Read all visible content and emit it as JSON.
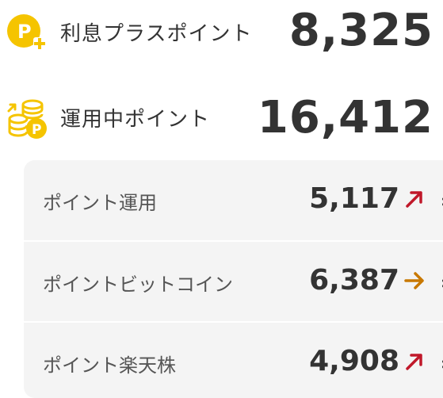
{
  "summary": {
    "interest_plus": {
      "label": "利息プラスポイント",
      "value": "8,325",
      "icon": "p-plus-coin-icon"
    },
    "invested": {
      "label": "運用中ポイント",
      "value": "16,412",
      "icon": "coin-stack-up-arrow-icon"
    }
  },
  "details": [
    {
      "label": "ポイント運用",
      "value": "5,117",
      "trend": "up",
      "trend_color": "#c0182a"
    },
    {
      "label": "ポイントビットコイン",
      "value": "6,387",
      "trend": "flat",
      "trend_color": "#c87800"
    },
    {
      "label": "ポイント楽天株",
      "value": "4,908",
      "trend": "up",
      "trend_color": "#c0182a"
    }
  ],
  "colors": {
    "coin_yellow": "#f5c400",
    "panel_bg": "#f4f4f4",
    "text_dark": "#333333"
  }
}
